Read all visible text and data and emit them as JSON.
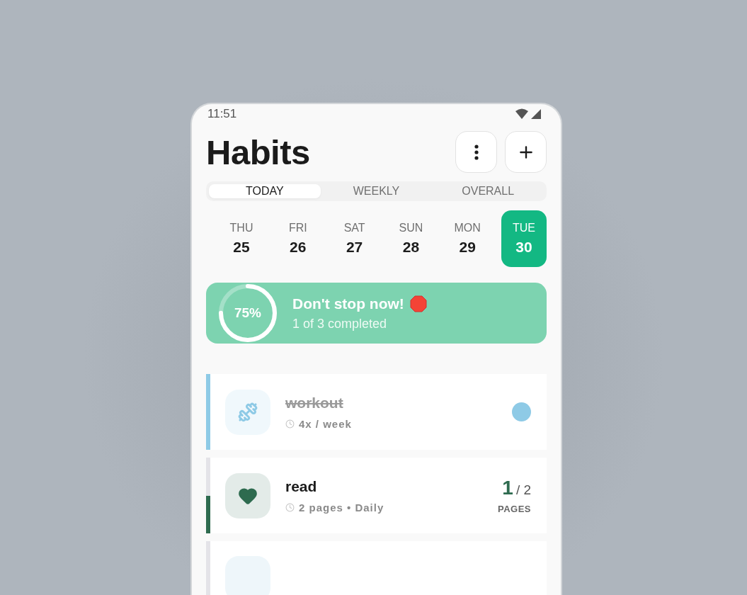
{
  "status_bar": {
    "time": "11:51"
  },
  "header": {
    "title": "Habits"
  },
  "tabs": [
    {
      "label": "TODAY",
      "selected": true
    },
    {
      "label": "WEEKLY",
      "selected": false
    },
    {
      "label": "OVERALL",
      "selected": false
    }
  ],
  "days": [
    {
      "weekday": "THU",
      "date": "25",
      "selected": false
    },
    {
      "weekday": "FRI",
      "date": "26",
      "selected": false
    },
    {
      "weekday": "SAT",
      "date": "27",
      "selected": false
    },
    {
      "weekday": "SUN",
      "date": "28",
      "selected": false
    },
    {
      "weekday": "MON",
      "date": "29",
      "selected": false
    },
    {
      "weekday": "TUE",
      "date": "30",
      "selected": true
    }
  ],
  "summary": {
    "percent": "75%",
    "level": 0.75,
    "title": "Don't stop now!",
    "subtitle": "1 of 3 completed"
  },
  "habits": [
    {
      "kind": "check",
      "name": "workout",
      "schedule": "4x / week",
      "completed": true,
      "level": 1,
      "color": "#8ecae6"
    },
    {
      "kind": "count",
      "name": "read",
      "schedule": "2 pages • Daily",
      "completed": false,
      "level": 0.5,
      "color": "#2e6b4f",
      "count": "1",
      "target": "/ 2",
      "unit": "PAGES"
    },
    {
      "kind": "partial"
    }
  ]
}
